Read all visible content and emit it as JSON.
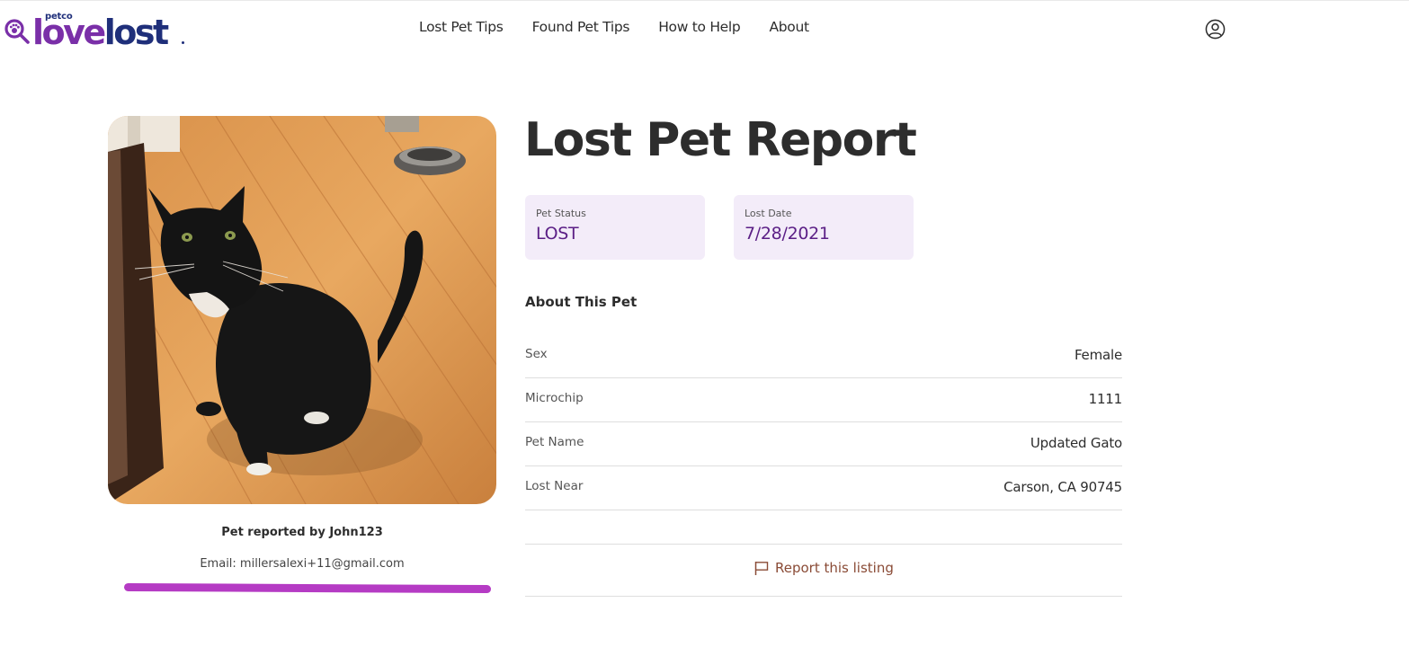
{
  "brand": {
    "petco": "petco",
    "love": "love",
    "lost": "lost"
  },
  "nav": {
    "items": [
      {
        "label": "Lost Pet Tips"
      },
      {
        "label": "Found Pet Tips"
      },
      {
        "label": "How to Help"
      },
      {
        "label": "About"
      }
    ],
    "account_icon": "user-circle-icon"
  },
  "reporter": {
    "reported_by": "Pet reported by John123",
    "email": "Email: millersalexi+11@gmail.com"
  },
  "report": {
    "title": "Lost Pet Report",
    "status": {
      "label": "Pet Status",
      "value": "LOST"
    },
    "lost_date": {
      "label": "Lost Date",
      "value": "7/28/2021"
    },
    "about_heading": "About This Pet",
    "details": [
      {
        "label": "Sex",
        "value": "Female"
      },
      {
        "label": "Microchip",
        "value": "1111"
      },
      {
        "label": "Pet Name",
        "value": "Updated Gato"
      },
      {
        "label": "Lost Near",
        "value": "Carson, CA 90745"
      }
    ],
    "report_listing": "Report this listing"
  },
  "colors": {
    "brand_purple": "#7a2fa8",
    "brand_navy": "#1f2f7a",
    "stat_bg": "#f3ecf9",
    "stat_value": "#5b1f86",
    "highlight": "#b53bc4",
    "report_link": "#8a4b36"
  }
}
